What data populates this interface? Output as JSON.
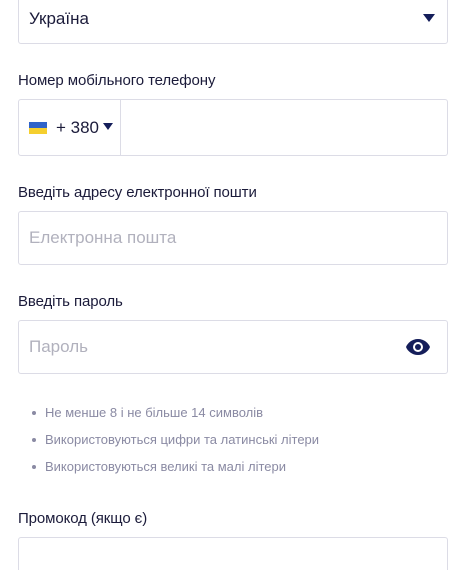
{
  "country": {
    "value": "Україна"
  },
  "phone": {
    "label": "Номер мобільного телефону",
    "code": "+ 380",
    "value": ""
  },
  "email": {
    "label": "Введіть адресу електронної пошти",
    "placeholder": "Електронна пошта",
    "value": ""
  },
  "password": {
    "label": "Введіть пароль",
    "placeholder": "Пароль",
    "value": ""
  },
  "password_rules": [
    "Не менше 8 і не більше 14 символів",
    "Використовуються цифри та латинські літери",
    "Використовуються великі та малі літери"
  ],
  "promo": {
    "label": "Промокод (якщо є)",
    "value": ""
  },
  "colors": {
    "accent": "#151e5a",
    "border": "#dcdce6",
    "hint": "#8a8aa3",
    "placeholder": "#b1b1bd"
  },
  "icons": {
    "country_dropdown": "chevron-down-icon",
    "phone_flag": "ukraine-flag-icon",
    "password_toggle": "eye-icon"
  }
}
